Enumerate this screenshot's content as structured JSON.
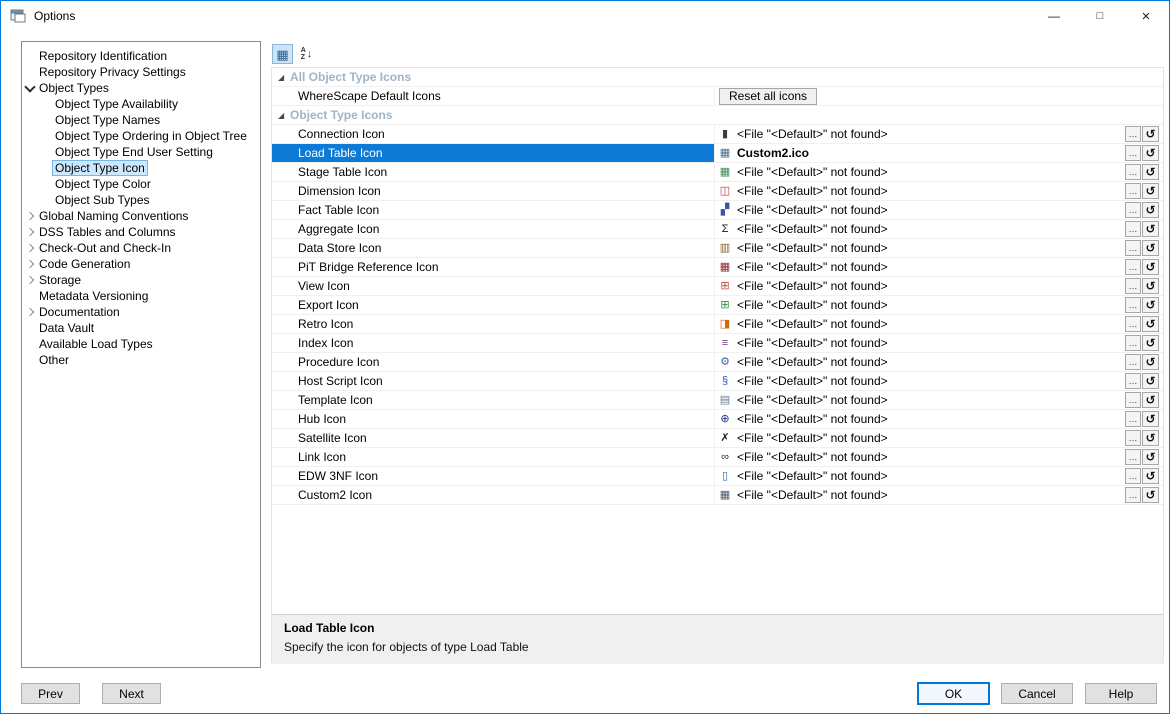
{
  "window": {
    "title": "Options",
    "controls": {
      "minimize": "—",
      "maximize": "□",
      "close": "×"
    }
  },
  "colors": {
    "accent_border": "#0078d7",
    "selection": "#0d7ad6",
    "category_text": "#a0b4c8",
    "tree_selection_bg": "#cce8ff",
    "tree_selection_border": "#77b7e4"
  },
  "sidebar": {
    "items": [
      {
        "label": "Repository Identification",
        "level": 1,
        "expander": "none"
      },
      {
        "label": "Repository Privacy Settings",
        "level": 1,
        "expander": "none"
      },
      {
        "label": "Object Types",
        "level": 1,
        "expander": "expanded"
      },
      {
        "label": "Object Type Availability",
        "level": 2,
        "expander": "none"
      },
      {
        "label": "Object Type Names",
        "level": 2,
        "expander": "none"
      },
      {
        "label": "Object Type Ordering in Object Tree",
        "level": 2,
        "expander": "none"
      },
      {
        "label": "Object Type End User Setting",
        "level": 2,
        "expander": "none"
      },
      {
        "label": "Object Type Icon",
        "level": 2,
        "expander": "none",
        "selected": true
      },
      {
        "label": "Object Type Color",
        "level": 2,
        "expander": "none"
      },
      {
        "label": "Object Sub Types",
        "level": 2,
        "expander": "none"
      },
      {
        "label": "Global Naming Conventions",
        "level": 1,
        "expander": "collapsed"
      },
      {
        "label": "DSS Tables and Columns",
        "level": 1,
        "expander": "collapsed"
      },
      {
        "label": "Check-Out and Check-In",
        "level": 1,
        "expander": "collapsed"
      },
      {
        "label": "Code Generation",
        "level": 1,
        "expander": "collapsed"
      },
      {
        "label": "Storage",
        "level": 1,
        "expander": "collapsed"
      },
      {
        "label": "Metadata Versioning",
        "level": 1,
        "expander": "none"
      },
      {
        "label": "Documentation",
        "level": 1,
        "expander": "collapsed"
      },
      {
        "label": "Data Vault",
        "level": 1,
        "expander": "none"
      },
      {
        "label": "Available Load Types",
        "level": 1,
        "expander": "none"
      },
      {
        "label": "Other",
        "level": 1,
        "expander": "none"
      }
    ]
  },
  "toolbar": {
    "categorized_glyph": "▦",
    "sort_letters": [
      "A",
      "Z"
    ],
    "sort_arrow": "↓"
  },
  "grid": {
    "marker": "◢",
    "row_buttons": {
      "browse": "…",
      "reset_glyph": "↺"
    },
    "categories": [
      {
        "label": "All Object Type Icons",
        "rows": [
          {
            "label": "WhereScape Default Icons",
            "kind": "button",
            "button": "Reset all icons"
          }
        ]
      },
      {
        "label": "Object Type Icons",
        "rows": [
          {
            "label": "Connection Icon",
            "value": "<File \"<Default>\" not found>",
            "icon": "connection-icon",
            "glyph": "▮",
            "glyph_color": "#3a3f44"
          },
          {
            "label": "Load Table Icon",
            "value": "Custom2.ico",
            "icon": "load-table-icon",
            "glyph": "▦",
            "glyph_color": "#4a6b8a",
            "selected": true,
            "value_bold": true
          },
          {
            "label": "Stage Table Icon",
            "value": "<File \"<Default>\" not found>",
            "icon": "stage-table-icon",
            "glyph": "▦",
            "glyph_color": "#3f8a4f"
          },
          {
            "label": "Dimension Icon",
            "value": "<File \"<Default>\" not found>",
            "icon": "dimension-icon",
            "glyph": "◫",
            "glyph_color": "#c23b3b"
          },
          {
            "label": "Fact Table Icon",
            "value": "<File \"<Default>\" not found>",
            "icon": "fact-table-icon",
            "glyph": "▞",
            "glyph_color": "#3a56a8"
          },
          {
            "label": "Aggregate Icon",
            "value": "<File \"<Default>\" not found>",
            "icon": "aggregate-icon",
            "glyph": "Σ",
            "glyph_color": "#15181c"
          },
          {
            "label": "Data Store Icon",
            "value": "<File \"<Default>\" not found>",
            "icon": "data-store-icon",
            "glyph": "▥",
            "glyph_color": "#8a5a2a"
          },
          {
            "label": "PiT Bridge Reference Icon",
            "value": "<File \"<Default>\" not found>",
            "icon": "pit-bridge-reference-icon",
            "glyph": "▦",
            "glyph_color": "#8a2424"
          },
          {
            "label": "View Icon",
            "value": "<File \"<Default>\" not found>",
            "icon": "view-icon",
            "glyph": "⊞",
            "glyph_color": "#c24a3a"
          },
          {
            "label": "Export Icon",
            "value": "<File \"<Default>\" not found>",
            "icon": "export-icon",
            "glyph": "⊞",
            "glyph_color": "#2e8a3e"
          },
          {
            "label": "Retro Icon",
            "value": "<File \"<Default>\" not found>",
            "icon": "retro-icon",
            "glyph": "◨",
            "glyph_color": "#d06a14"
          },
          {
            "label": "Index Icon",
            "value": "<File \"<Default>\" not found>",
            "icon": "index-icon",
            "glyph": "≡",
            "glyph_color": "#7a3a8a"
          },
          {
            "label": "Procedure Icon",
            "value": "<File \"<Default>\" not found>",
            "icon": "procedure-icon",
            "glyph": "⚙",
            "glyph_color": "#3a6aaa"
          },
          {
            "label": "Host Script Icon",
            "value": "<File \"<Default>\" not found>",
            "icon": "host-script-icon",
            "glyph": "§",
            "glyph_color": "#2a5ac2"
          },
          {
            "label": "Template Icon",
            "value": "<File \"<Default>\" not found>",
            "icon": "template-icon",
            "glyph": "▤",
            "glyph_color": "#6a7a8a"
          },
          {
            "label": "Hub Icon",
            "value": "<File \"<Default>\" not found>",
            "icon": "hub-icon",
            "glyph": "⊕",
            "glyph_color": "#23308a"
          },
          {
            "label": "Satellite Icon",
            "value": "<File \"<Default>\" not found>",
            "icon": "satellite-icon",
            "glyph": "✗",
            "glyph_color": "#20242a"
          },
          {
            "label": "Link Icon",
            "value": "<File \"<Default>\" not found>",
            "icon": "link-icon",
            "glyph": "∞",
            "glyph_color": "#2a2f36"
          },
          {
            "label": "EDW 3NF Icon",
            "value": "<File \"<Default>\" not found>",
            "icon": "edw-3nf-icon",
            "glyph": "▯",
            "glyph_color": "#3060c0"
          },
          {
            "label": "Custom2 Icon",
            "value": "<File \"<Default>\" not found>",
            "icon": "custom2-icon",
            "glyph": "▦",
            "glyph_color": "#46566a"
          }
        ]
      }
    ]
  },
  "description": {
    "title": "Load Table Icon",
    "text": "Specify the icon for objects of type Load Table"
  },
  "footer": {
    "prev": "Prev",
    "next": "Next",
    "ok": "OK",
    "cancel": "Cancel",
    "help": "Help"
  }
}
